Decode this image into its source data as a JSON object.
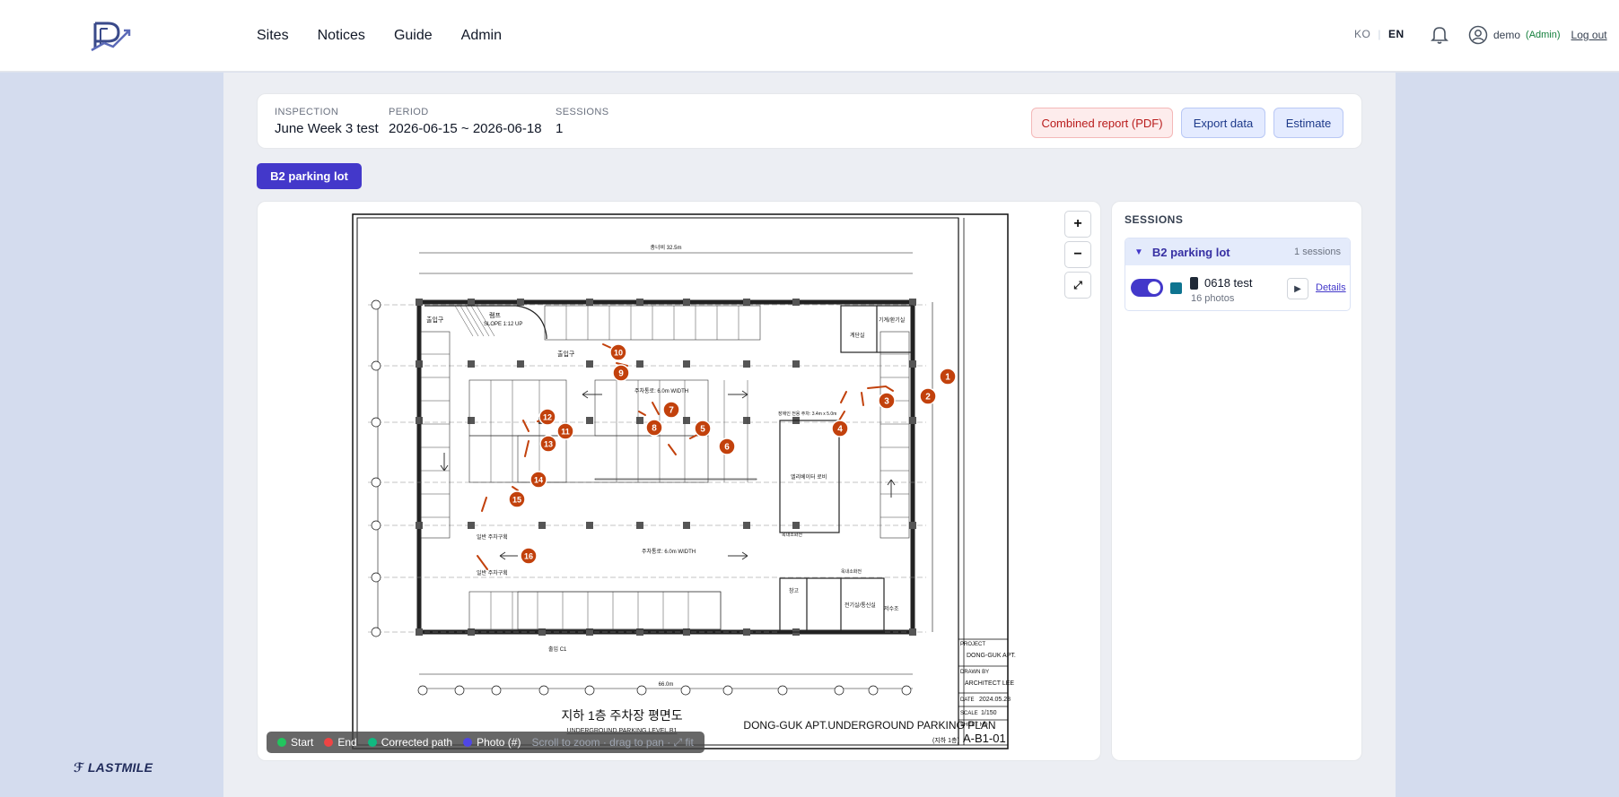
{
  "header": {
    "nav": [
      "Sites",
      "Notices",
      "Guide",
      "Admin"
    ],
    "lang": {
      "ko": "KO",
      "sep": "|",
      "en": "EN"
    },
    "user": {
      "name": "demo",
      "role": "(Admin)",
      "logout": "Log out"
    }
  },
  "brand": "LASTMILE",
  "inspection": {
    "inspection_label": "INSPECTION",
    "inspection_value": "June Week 3 test",
    "period_label": "PERIOD",
    "period_value": "2026-06-15 ~ 2026-06-18",
    "sessions_label": "SESSIONS",
    "sessions_value": "1",
    "buttons": {
      "pdf": "Combined report (PDF)",
      "export": "Export data",
      "estimate": "Estimate"
    }
  },
  "tab": "B2 parking lot",
  "map": {
    "zoom_in": "+",
    "zoom_out": "−",
    "fit": "⤢",
    "legend": {
      "start": "Start",
      "end": "End",
      "corrected": "Corrected path",
      "photo": "Photo (#)",
      "hint": "Scroll to zoom · drag to pan · ⤢ fit"
    },
    "colors": {
      "start": "#22c55e",
      "end": "#ef4444",
      "corrected": "#10b981",
      "photo": "#4f46e5",
      "marker": "#c2410c"
    },
    "photo_markers": [
      "1",
      "2",
      "3",
      "4",
      "5",
      "6",
      "7",
      "8",
      "9",
      "10",
      "11",
      "12",
      "13",
      "14",
      "15",
      "16"
    ],
    "plan": {
      "title_en": "DONG-GUK APT.UNDERGROUND PARKING PLAN",
      "title_ko": "지하 1층 주차장 평면도",
      "subtitle": "UNDERGROUND PARKING LEVEL B1",
      "project_label": "PROJECT",
      "project": "DONG-GUK APT.",
      "drawn_label": "DRAWN BY",
      "drawn": "ARCHITECT LEE",
      "date_label": "DATE",
      "date": "2024.05.28",
      "scale_label": "SCALE",
      "scale": "1/150",
      "sheet_label": "SHEET NO",
      "sheet": "A-B1-01",
      "sheet_sub": "(지하 1층)",
      "aisle": "주차통로: 6.0m WIDTH",
      "disabled": "장애인 전용 주차: 3.4m x 5.0m",
      "ramp": "램프",
      "ramp_slope": "SLOPE 1:12 UP",
      "exit1": "출입구",
      "exit2": "출입구",
      "exit3": "출입 C1",
      "stairs": "계단실",
      "machine": "기계/환기실",
      "lobby": "엘리베이터 로비",
      "storage": "창고",
      "elec": "전기실/통신실",
      "tank": "저수조",
      "parking": "일반 주차구획",
      "fire": "옥내소화전",
      "total": "총너비 32.5m",
      "total2": "66.0m"
    }
  },
  "sessions": {
    "title": "SESSIONS",
    "group": {
      "name": "B2 parking lot",
      "count": "1 sessions"
    },
    "item": {
      "name": "0618 test",
      "photos": "16 photos",
      "details": "Details",
      "color": "#0e7490"
    }
  }
}
